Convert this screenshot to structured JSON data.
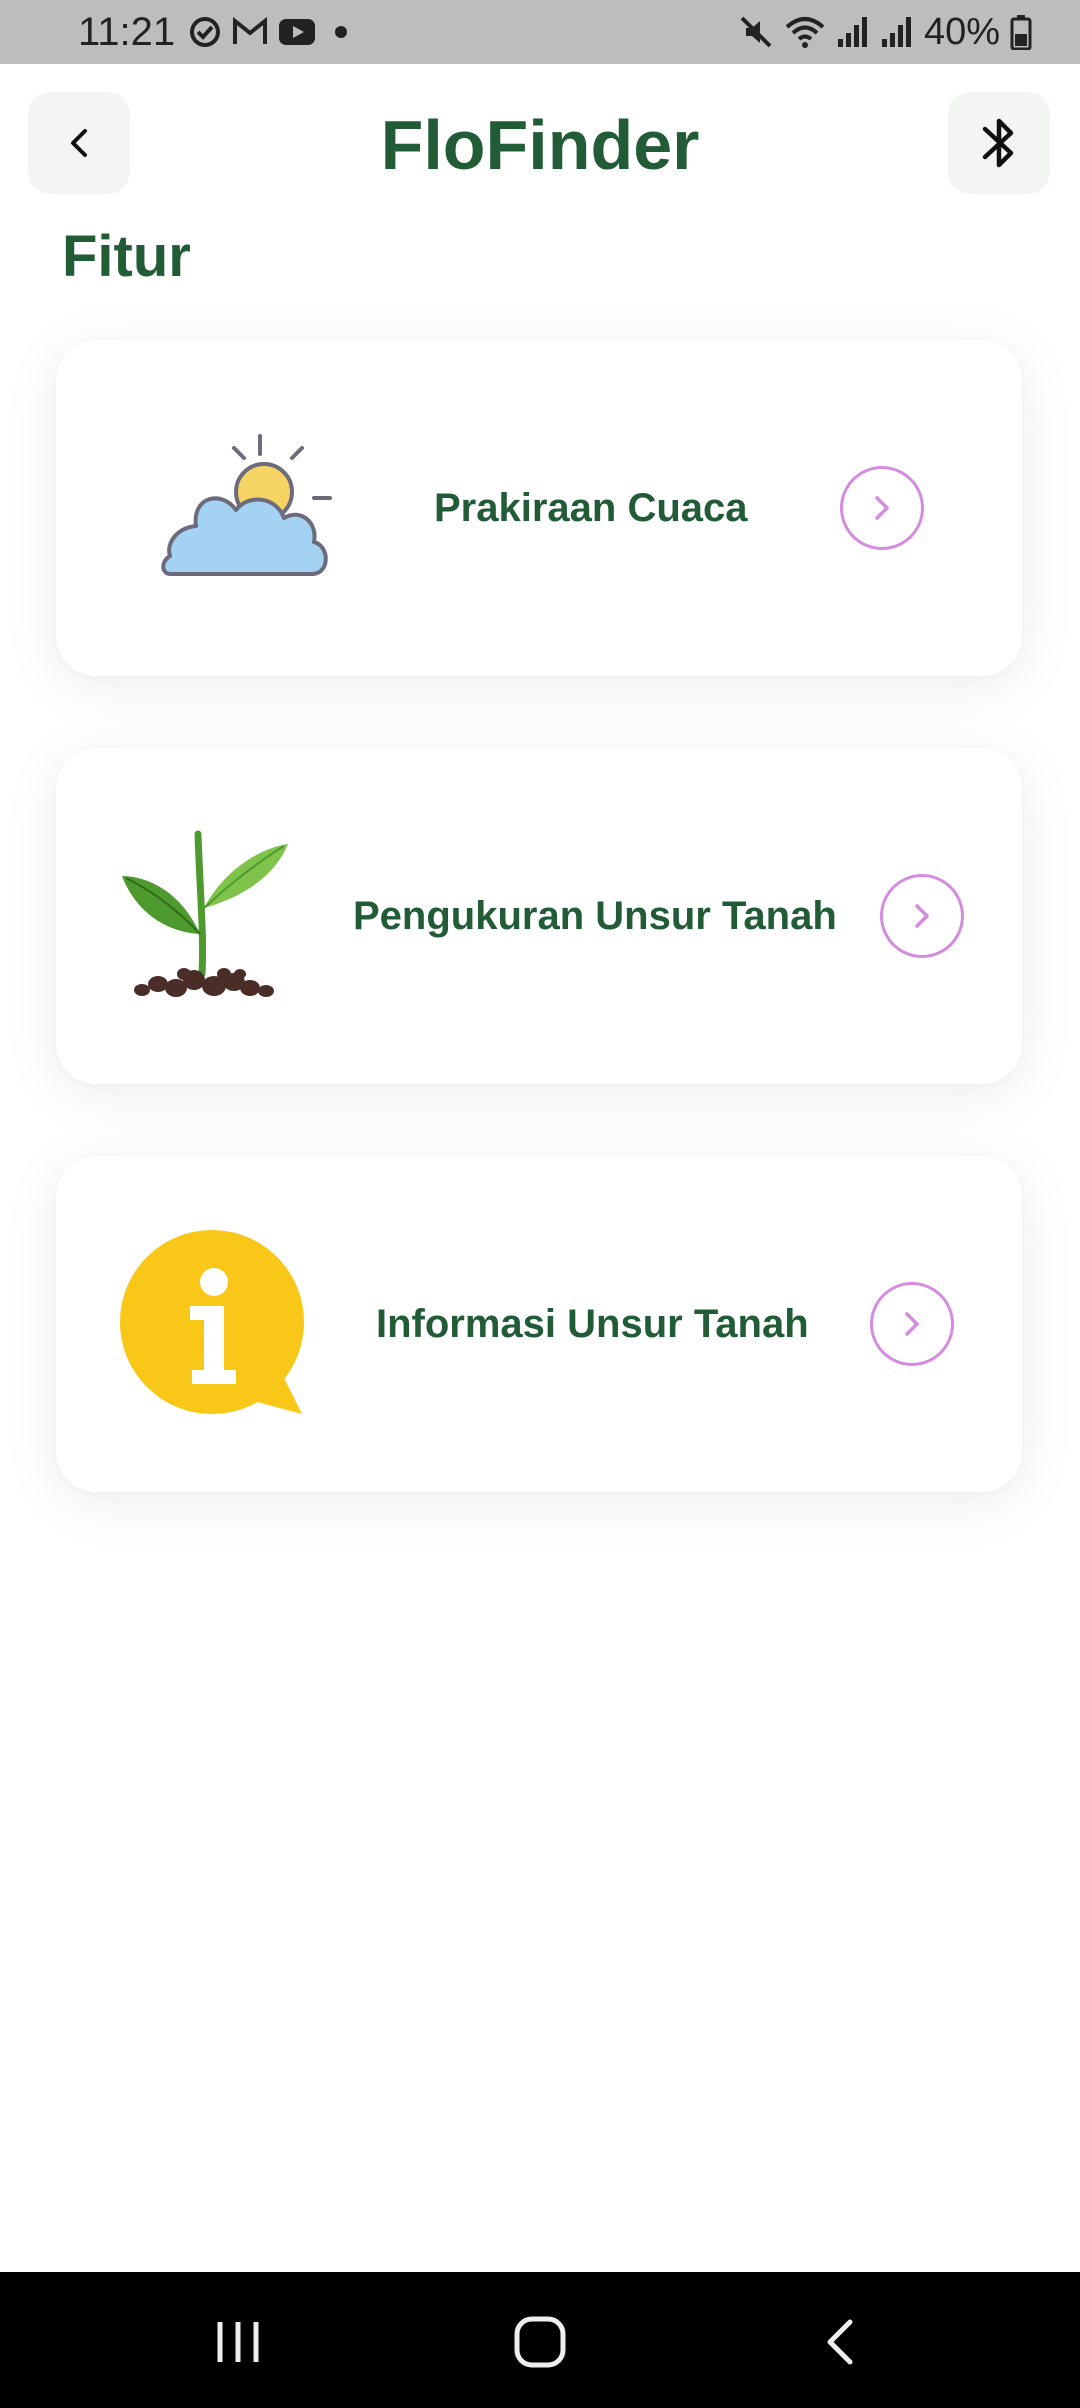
{
  "status_bar": {
    "time": "11:21",
    "battery": "40%",
    "left_icons": [
      "sync-icon",
      "gmail-icon",
      "youtube-icon",
      "dot-icon"
    ],
    "right_icons": [
      "mute-icon",
      "wifi-icon",
      "signal-icon",
      "signal-icon",
      "battery-icon"
    ]
  },
  "app_bar": {
    "title": "FloFinder",
    "back_icon": "chevron-left-icon",
    "bluetooth_icon": "bluetooth-icon"
  },
  "section_title": "Fitur",
  "features": [
    {
      "label": "Prakiraan Cuaca",
      "icon": "weather-icon"
    },
    {
      "label": "Pengukuran Unsur Tanah",
      "icon": "plant-icon"
    },
    {
      "label": "Informasi Unsur Tanah",
      "icon": "info-icon"
    }
  ],
  "nav_bar": {
    "icons": [
      "recent-apps-icon",
      "home-icon",
      "back-icon"
    ]
  },
  "colors": {
    "primary_green": "#215c36",
    "chevron_purple": "#d58be0",
    "status_bar_bg": "#bdbdbd",
    "nav_bar_bg": "#000000",
    "info_yellow": "#f8c718"
  }
}
